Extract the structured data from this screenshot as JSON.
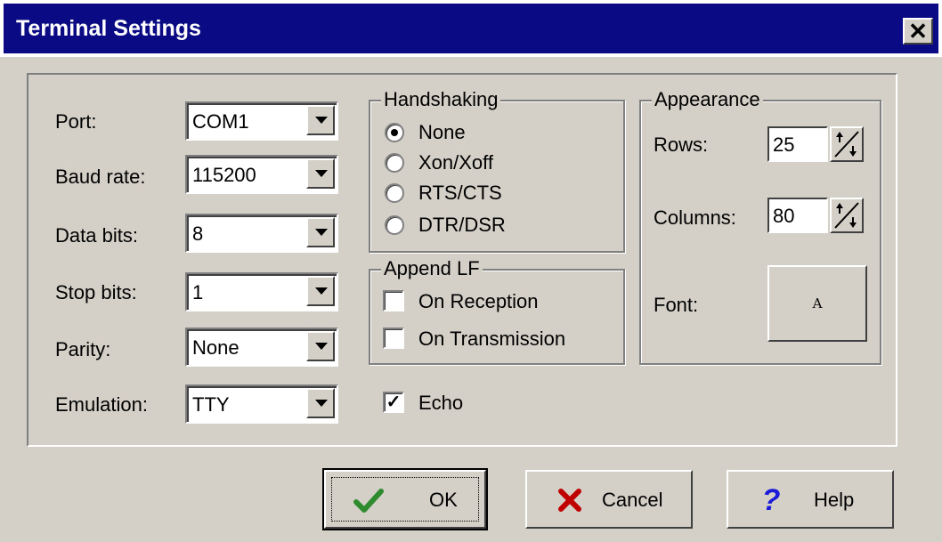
{
  "window": {
    "title": "Terminal Settings",
    "close_icon": "close-icon"
  },
  "serial": {
    "port": {
      "label": "Port:",
      "value": "COM1"
    },
    "baud_rate": {
      "label": "Baud rate:",
      "value": "115200"
    },
    "data_bits": {
      "label": "Data bits:",
      "value": "8"
    },
    "stop_bits": {
      "label": "Stop bits:",
      "value": "1"
    },
    "parity": {
      "label": "Parity:",
      "value": "None"
    },
    "emulation": {
      "label": "Emulation:",
      "value": "TTY"
    }
  },
  "handshaking": {
    "title": "Handshaking",
    "options": [
      "None",
      "Xon/Xoff",
      "RTS/CTS",
      "DTR/DSR"
    ],
    "selected": "None"
  },
  "append_lf": {
    "title": "Append LF",
    "on_reception": {
      "label": "On Reception",
      "checked": false
    },
    "on_transmission": {
      "label": "On Transmission",
      "checked": false
    }
  },
  "echo": {
    "label": "Echo",
    "checked": true
  },
  "appearance": {
    "title": "Appearance",
    "rows": {
      "label": "Rows:",
      "value": "25"
    },
    "columns": {
      "label": "Columns:",
      "value": "80"
    },
    "font": {
      "label": "Font:",
      "preview": "A"
    }
  },
  "buttons": {
    "ok": "OK",
    "cancel": "Cancel",
    "help": "Help"
  },
  "colors": {
    "title_bar": "#0a0a84",
    "face": "#d4d0c8",
    "ok_check": "#2e8b2e",
    "cancel_x": "#c00000",
    "help_q": "#1a1ad8"
  }
}
